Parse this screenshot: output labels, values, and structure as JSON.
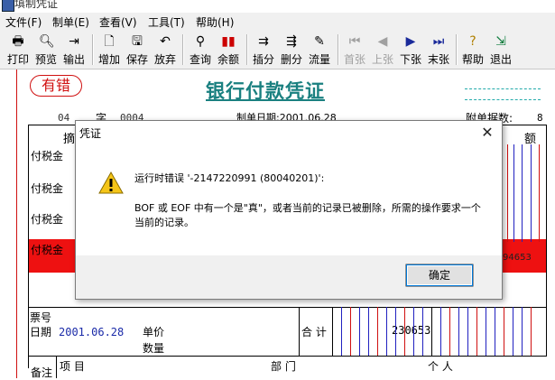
{
  "window": {
    "title": "填制凭证"
  },
  "menu": [
    "文件(F)",
    "制单(E)",
    "查看(V)",
    "工具(T)",
    "帮助(H)"
  ],
  "toolbar": {
    "print": "打印",
    "preview": "预览",
    "export": "输出",
    "add": "增加",
    "save": "保存",
    "abandon": "放弃",
    "query": "查询",
    "balance": "余额",
    "insert_row": "插分",
    "delete_row": "删分",
    "flow": "流量",
    "first": "首张",
    "prev": "上张",
    "next": "下张",
    "last": "末张",
    "help": "帮助",
    "exit": "退出"
  },
  "voucher": {
    "error_badge": "有错",
    "title": "银行付款凭证",
    "word_label": "字",
    "number_prefix": "04",
    "number": "0004",
    "date_label": "制单日期:2001.06.28",
    "attachments_label": "附单据数:",
    "attachments_value": "8",
    "col_summary_partial": "摘",
    "col_amount_partial": "额",
    "rows": [
      "付税金",
      "付税金",
      "付税金",
      "付税金"
    ],
    "red_row_amount_partial": "94653",
    "ticket_label": "票号",
    "date_field_label": "日期",
    "date_value": "2001.06.28",
    "unit_price_label": "单价",
    "quantity_label": "数量",
    "total_label": "合 计",
    "total_value": "230653",
    "remark_label": "备注",
    "project_label": "项  目",
    "dept_label": "部  门",
    "person_label": "个  人"
  },
  "dialog": {
    "title": "凭证",
    "close": "✕",
    "message_line1": "运行时错误 '-2147220991 (80040201)':",
    "message_line2": "BOF 或 EOF 中有一个是\"真\"，或者当前的记录已被删除，所需的操作要求一个当前的记录。",
    "ok_button": "确定"
  },
  "colors": {
    "error_red": "#d01010",
    "title_teal": "#1a8080",
    "grid_blue": "#2020c0"
  }
}
